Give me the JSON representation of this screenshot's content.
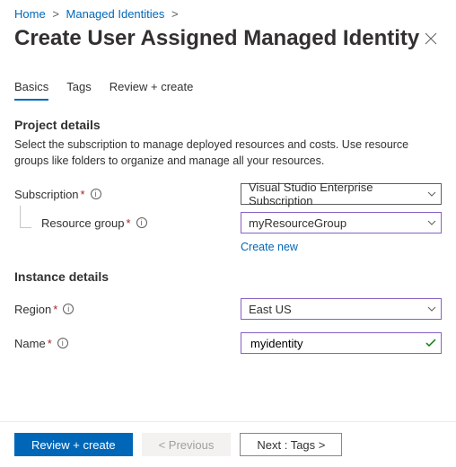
{
  "breadcrumb": {
    "home": "Home",
    "managed_identities": "Managed Identities"
  },
  "title": "Create User Assigned Managed Identity",
  "tabs": {
    "basics": "Basics",
    "tags": "Tags",
    "review": "Review + create"
  },
  "project_details": {
    "heading": "Project details",
    "description": "Select the subscription to manage deployed resources and costs. Use resource groups like folders to organize and manage all your resources.",
    "subscription_label": "Subscription",
    "subscription_value": "Visual Studio Enterprise Subscription",
    "resource_group_label": "Resource group",
    "resource_group_value": "myResourceGroup",
    "create_new": "Create new"
  },
  "instance_details": {
    "heading": "Instance details",
    "region_label": "Region",
    "region_value": "East US",
    "name_label": "Name",
    "name_value": "myidentity"
  },
  "footer": {
    "review": "Review + create",
    "previous": "< Previous",
    "next": "Next : Tags >"
  }
}
